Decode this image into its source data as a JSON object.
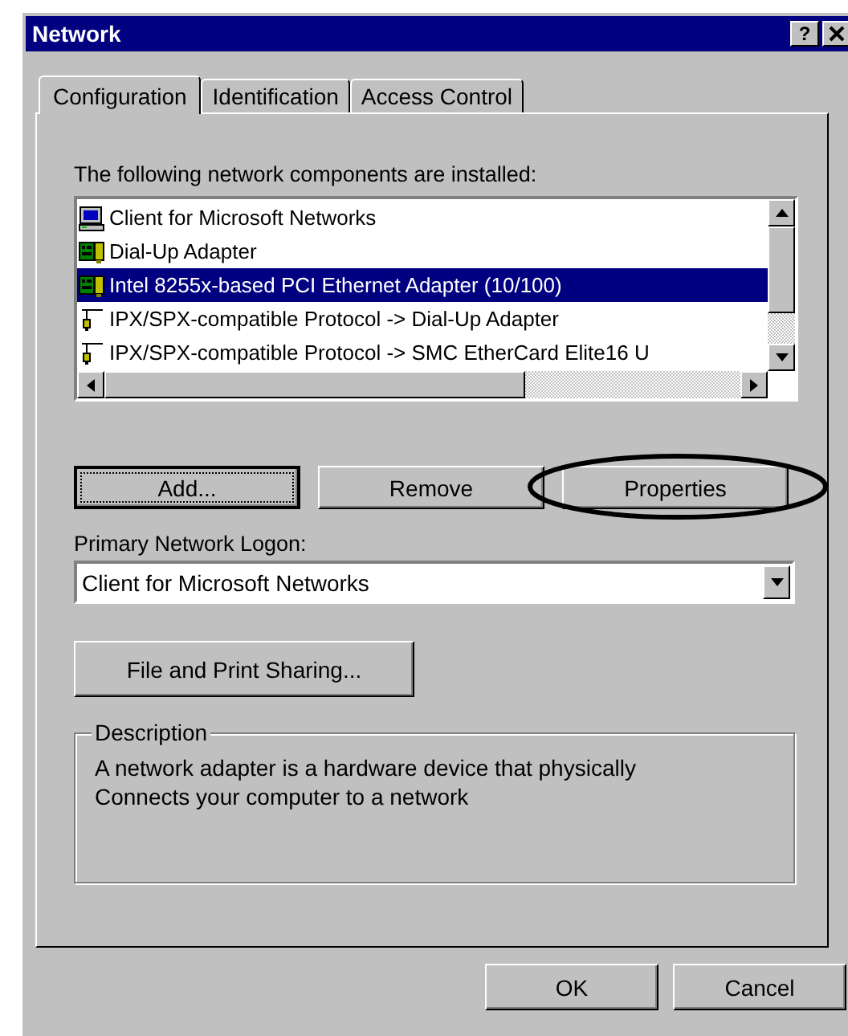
{
  "window": {
    "title": "Network",
    "help_button": "?"
  },
  "tabs": [
    {
      "label": "Configuration",
      "selected": true
    },
    {
      "label": "Identification",
      "selected": false
    },
    {
      "label": "Access Control",
      "selected": false
    }
  ],
  "components_label": "The following network components are installed:",
  "components": [
    {
      "kind": "client",
      "label": "Client for Microsoft Networks",
      "selected": false
    },
    {
      "kind": "adapter",
      "label": "Dial-Up Adapter",
      "selected": false
    },
    {
      "kind": "adapter",
      "label": "Intel 8255x-based PCI Ethernet Adapter (10/100)",
      "selected": true
    },
    {
      "kind": "protocol",
      "label": "IPX/SPX-compatible Protocol -> Dial-Up Adapter",
      "selected": false
    },
    {
      "kind": "protocol",
      "label": "IPX/SPX-compatible Protocol -> SMC EtherCard Elite16 U",
      "selected": false
    }
  ],
  "component_buttons": [
    {
      "label": "Add...",
      "focused": true,
      "circled": false
    },
    {
      "label": "Remove",
      "focused": false,
      "circled": false
    },
    {
      "label": "Properties",
      "focused": false,
      "circled": true
    }
  ],
  "logon": {
    "label": "Primary Network Logon:",
    "value": "Client for Microsoft Networks"
  },
  "sharing_button": "File and Print Sharing...",
  "description": {
    "title": "Description",
    "lines": [
      "A network adapter is a hardware device that physically",
      "Connects your computer to a network"
    ]
  },
  "dialog_buttons": [
    "OK",
    "Cancel"
  ]
}
